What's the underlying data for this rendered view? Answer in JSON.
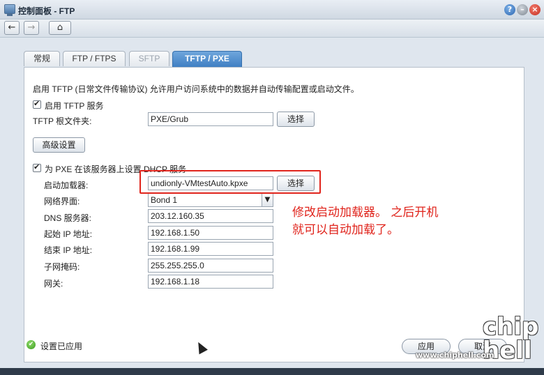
{
  "window": {
    "title": "控制面板 - FTP",
    "help_glyph": "?",
    "min_glyph": "–",
    "close_glyph": "×"
  },
  "nav": {
    "back_glyph": "←",
    "forward_glyph": "→",
    "home_glyph": "⌂"
  },
  "tabs": [
    {
      "label": "常规"
    },
    {
      "label": "FTP / FTPS"
    },
    {
      "label": "SFTP"
    },
    {
      "label": "TFTP / PXE"
    }
  ],
  "panel": {
    "description": "启用 TFTP (日常文件传输协议) 允许用户访问系统中的数据并自动传输配置或启动文件。",
    "enable_tftp_label": "启用 TFTP 服务",
    "tftp_root_label": "TFTP 根文件夹:",
    "tftp_root_value": "PXE/Grub",
    "select_label": "选择",
    "advanced_label": "高级设置",
    "pxe_dhcp_label": "为 PXE 在该服务器上设置 DHCP 服务",
    "boot_loader_label": "启动加载器:",
    "boot_loader_value": "undionly-VMtestAuto.kpxe",
    "network_interface_label": "网络界面:",
    "network_interface_value": "Bond 1",
    "dns_label": "DNS 服务器:",
    "dns_value": "203.12.160.35",
    "start_ip_label": "起始 IP 地址:",
    "start_ip_value": "192.168.1.50",
    "end_ip_label": "结束 IP 地址:",
    "end_ip_value": "192.168.1.99",
    "subnet_label": "子网掩码:",
    "subnet_value": "255.255.255.0",
    "gateway_label": "网关:",
    "gateway_value": "192.168.1.18"
  },
  "annotation": {
    "line1": "修改启动加载器。  之后开机",
    "line2": "就可以自动加载了。"
  },
  "footer": {
    "status": "设置已应用",
    "apply_label": "应用",
    "cancel_label": "取消",
    "status_icon": "check-circle-icon"
  },
  "watermark": {
    "logo": "chip hell",
    "url": "www.chiphell.com"
  },
  "colors": {
    "accent_tab": "#3f7fc3",
    "annotation_red": "#e0241c"
  }
}
